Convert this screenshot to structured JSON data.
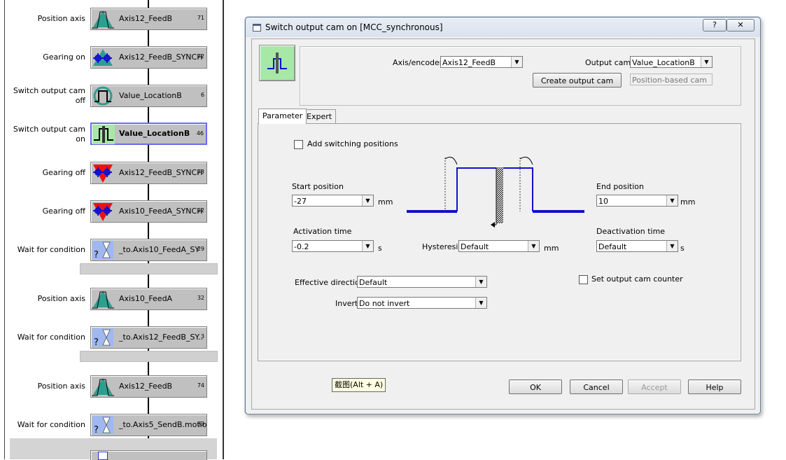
{
  "chart": {
    "commands": [
      {
        "label": "Position axis",
        "name": "Axis12_FeedB",
        "num": "71",
        "icon": "position-axis-icon"
      },
      {
        "label": "Gearing on",
        "name": "Axis12_FeedB_SYNCH",
        "num": "72",
        "icon": "gearing-on-icon"
      },
      {
        "label": "Switch output cam off",
        "name": "Value_LocationB",
        "num": "6",
        "icon": "output-cam-off-icon"
      },
      {
        "label": "Switch output cam on",
        "name": "Value_LocationB",
        "num": "46",
        "icon": "output-cam-on-icon"
      },
      {
        "label": "Gearing off",
        "name": "Axis12_FeedB_SYNCH",
        "num": "73",
        "icon": "gearing-off-icon"
      },
      {
        "label": "Gearing off",
        "name": "Axis10_FeedA_SYNCH",
        "num": "22",
        "icon": "gearing-off-icon"
      },
      {
        "label": "Wait for condition",
        "name": "_to.Axis10_FeedA_SY",
        "num": "29",
        "icon": "wait-condition-icon"
      },
      {
        "label": "Position axis",
        "name": "Axis10_FeedA",
        "num": "32",
        "icon": "position-axis-icon"
      },
      {
        "label": "Wait for condition",
        "name": "_to.Axis12_FeedB_SY..",
        "num": "3",
        "icon": "wait-condition-icon"
      },
      {
        "label": "Position axis",
        "name": "Axis12_FeedB",
        "num": "74",
        "icon": "position-axis-icon"
      },
      {
        "label": "Wait for condition",
        "name": "_to.Axis5_SendB.motio",
        "num": "33",
        "icon": "wait-condition-icon"
      }
    ]
  },
  "dialog": {
    "title": "Switch output cam on [MCC_synchronous]",
    "help_glyph": "?",
    "close_glyph": "✕",
    "axis_encoder_label": "Axis/encoder",
    "axis_encoder_value": "Axis12_FeedB",
    "output_cam_label": "Output cam",
    "output_cam_value": "Value_LocationB",
    "create_output_cam_label": "Create output cam",
    "cam_type_value": "Position-based cam",
    "tabs": [
      "Parameter",
      "Expert"
    ],
    "active_tab": "Parameter",
    "add_switching_positions_label": "Add switching positions",
    "start_position_label": "Start position",
    "start_position_value": "-27",
    "start_position_unit": "mm",
    "end_position_label": "End position",
    "end_position_value": "10",
    "end_position_unit": "mm",
    "activation_time_label": "Activation time",
    "activation_time_value": "-0.2",
    "activation_time_unit": "s",
    "hysteresis_label": "Hysteresis",
    "hysteresis_value": "Default",
    "hysteresis_unit": "mm",
    "deactivation_time_label": "Deactivation time",
    "deactivation_time_value": "Default",
    "deactivation_time_unit": "s",
    "set_output_cam_counter_label": "Set output cam counter",
    "effective_direction_label": "Effective direction",
    "effective_direction_value": "Default",
    "invert_label": "Invert",
    "invert_value": "Do not invert",
    "tooltip": "截图(Alt + A)",
    "ok_label": "OK",
    "cancel_label": "Cancel",
    "accept_label": "Accept",
    "help_label": "Help"
  },
  "colors": {
    "teal": "#2e9e8e",
    "blue": "#1010cc",
    "red": "#ee1111",
    "cam_bg": "#a7e8a7",
    "wait_bg": "#9fb8f0"
  }
}
